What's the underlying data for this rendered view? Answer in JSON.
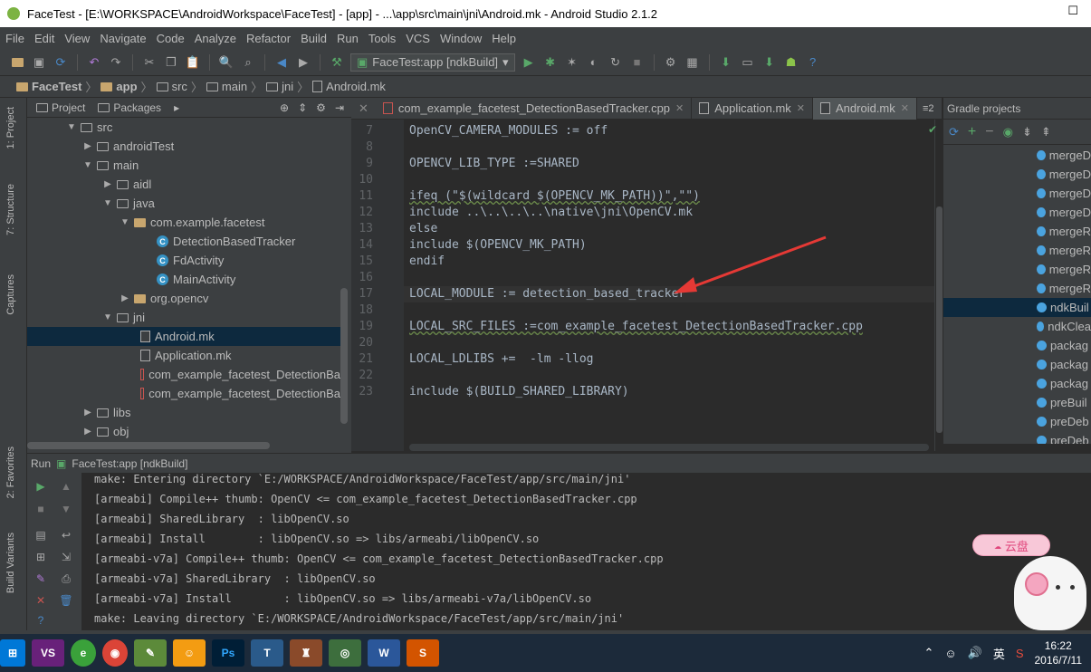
{
  "window": {
    "title": "FaceTest - [E:\\WORKSPACE\\AndroidWorkspace\\FaceTest] - [app] - ...\\app\\src\\main\\jni\\Android.mk - Android Studio 2.1.2"
  },
  "menu": [
    "File",
    "Edit",
    "View",
    "Navigate",
    "Code",
    "Analyze",
    "Refactor",
    "Build",
    "Run",
    "Tools",
    "VCS",
    "Window",
    "Help"
  ],
  "toolbar": {
    "run_config": "FaceTest:app [ndkBuild]"
  },
  "breadcrumb": [
    "FaceTest",
    "app",
    "src",
    "main",
    "jni",
    "Android.mk"
  ],
  "left_tabs": {
    "project": "1: Project",
    "structure": "7: Structure",
    "captures": "Captures",
    "favorites": "2: Favorites",
    "build_variants": "Build Variants"
  },
  "project_panel": {
    "tab_project": "Project",
    "tab_packages": "Packages"
  },
  "tree": [
    {
      "label": "src"
    },
    {
      "label": "androidTest"
    },
    {
      "label": "main"
    },
    {
      "label": "aidl"
    },
    {
      "label": "java"
    },
    {
      "label": "com.example.facetest"
    },
    {
      "label": "DetectionBasedTracker"
    },
    {
      "label": "FdActivity"
    },
    {
      "label": "MainActivity"
    },
    {
      "label": "org.opencv"
    },
    {
      "label": "jni"
    },
    {
      "label": "Android.mk"
    },
    {
      "label": "Application.mk"
    },
    {
      "label": "com_example_facetest_DetectionBa"
    },
    {
      "label": "com_example_facetest_DetectionBa"
    },
    {
      "label": "libs"
    },
    {
      "label": "obj"
    }
  ],
  "editor_tabs": [
    "com_example_facetest_DetectionBasedTracker.cpp",
    "Application.mk",
    "Android.mk"
  ],
  "editor_tabs_overflow": "≡2",
  "code": {
    "line_numbers": [
      "7",
      "8",
      "9",
      "10",
      "11",
      "12",
      "13",
      "14",
      "15",
      "16",
      "17",
      "18",
      "19",
      "20",
      "21",
      "22",
      "23"
    ],
    "lines": [
      "OpenCV_CAMERA_MODULES := off",
      "",
      "OPENCV_LIB_TYPE :=SHARED",
      "",
      "ifeq (\"$(wildcard $(OPENCV_MK_PATH))\",\"\")",
      "include ..\\..\\..\\..\\native\\jni\\OpenCV.mk",
      "else",
      "include $(OPENCV_MK_PATH)",
      "endif",
      "",
      "LOCAL_MODULE := detection_based_tracker",
      "",
      "LOCAL_SRC_FILES :=com_example_facetest_DetectionBasedTracker.cpp",
      "",
      "LOCAL_LDLIBS +=  -lm -llog",
      "",
      "include $(BUILD_SHARED_LIBRARY)"
    ]
  },
  "gradle": {
    "title": "Gradle projects",
    "tasks": [
      "mergeD",
      "mergeD",
      "mergeD",
      "mergeD",
      "mergeR",
      "mergeR",
      "mergeR",
      "mergeR",
      "ndkBuil",
      "ndkClea",
      "packag",
      "packag",
      "packag",
      "preBuil",
      "preDeb",
      "preDeb"
    ]
  },
  "run_panel": {
    "label": "Run",
    "config": "FaceTest:app [ndkBuild]",
    "output": [
      "make: Entering directory `E:/WORKSPACE/AndroidWorkspace/FaceTest/app/src/main/jni'",
      "[armeabi] Compile++ thumb: OpenCV <= com_example_facetest_DetectionBasedTracker.cpp",
      "[armeabi] SharedLibrary  : libOpenCV.so",
      "[armeabi] Install        : libOpenCV.so => libs/armeabi/libOpenCV.so",
      "[armeabi-v7a] Compile++ thumb: OpenCV <= com_example_facetest_DetectionBasedTracker.cpp",
      "[armeabi-v7a] SharedLibrary  : libOpenCV.so",
      "[armeabi-v7a] Install        : libOpenCV.so => libs/armeabi-v7a/libOpenCV.so",
      "make: Leaving directory `E:/WORKSPACE/AndroidWorkspace/FaceTest/app/src/main/jni'"
    ]
  },
  "floating_widget": {
    "label": "云盘"
  },
  "taskbar": {
    "apps": [
      "VS",
      "",
      "",
      "",
      "",
      "Ps",
      "",
      "",
      "",
      "W",
      "S"
    ],
    "ime": "英",
    "time": "16:22",
    "date": "2016/7/11"
  },
  "colors": {
    "accent": "#4a88c7",
    "run_green": "#59a869",
    "selection": "#0d293e"
  }
}
